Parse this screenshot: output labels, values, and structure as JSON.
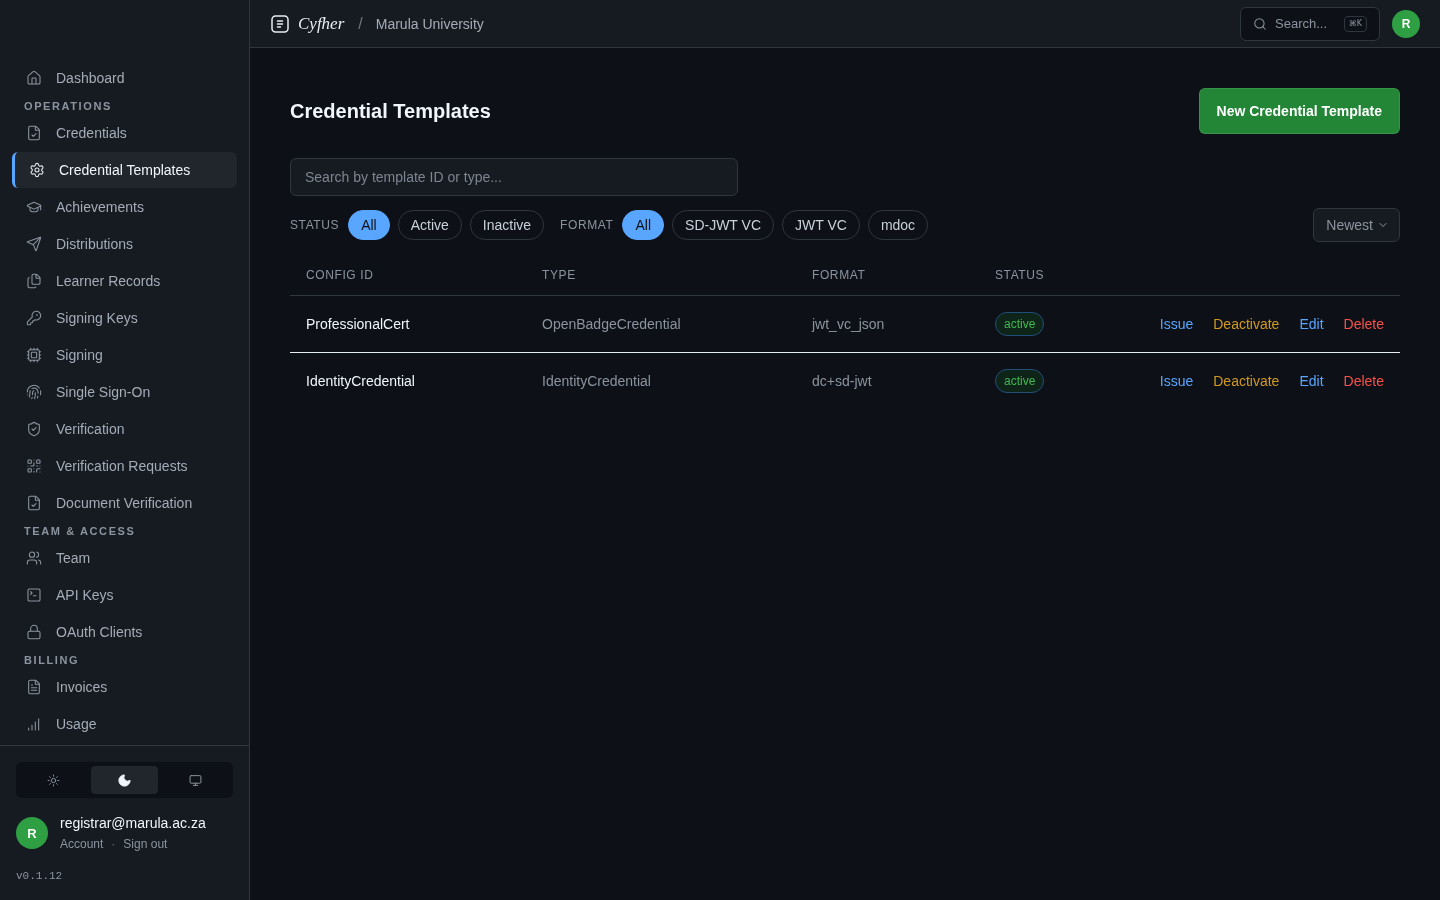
{
  "top_bar": {
    "brand": "Cyfher",
    "separator": "/",
    "organization": "Marula University",
    "search": {
      "label": "Search...",
      "shortcut": "⌘K"
    },
    "avatar": "R"
  },
  "sidebar": {
    "sections": [
      {
        "items": [
          {
            "label": "Dashboard",
            "selected": false
          }
        ]
      },
      {
        "title": "OPERATIONS",
        "items": [
          {
            "label": "Credentials",
            "selected": false
          },
          {
            "label": "Credential Templates",
            "selected": true
          },
          {
            "label": "Achievements",
            "selected": false
          },
          {
            "label": "Distributions",
            "selected": false
          },
          {
            "label": "Learner Records",
            "selected": false
          },
          {
            "label": "Signing Keys",
            "selected": false
          },
          {
            "label": "Signing",
            "selected": false
          },
          {
            "label": "Single Sign-On",
            "selected": false
          },
          {
            "label": "Verification",
            "selected": false
          },
          {
            "label": "Verification Requests",
            "selected": false
          },
          {
            "label": "Document Verification",
            "selected": false
          }
        ]
      },
      {
        "title": "TEAM & ACCESS",
        "items": [
          {
            "label": "Team",
            "selected": false
          },
          {
            "label": "API Keys",
            "selected": false
          },
          {
            "label": "OAuth Clients",
            "selected": false
          }
        ]
      },
      {
        "title": "BILLING",
        "items": [
          {
            "label": "Invoices",
            "selected": false
          },
          {
            "label": "Usage",
            "selected": false
          }
        ]
      }
    ],
    "theme_toggle": [
      {
        "kind": "light",
        "selected": false
      },
      {
        "kind": "dark",
        "selected": true
      },
      {
        "kind": "system",
        "selected": false
      }
    ],
    "user": {
      "avatar": "R",
      "email": "registrar@marula.ac.za",
      "links": [
        "Account",
        "Sign out"
      ],
      "separator": "·"
    },
    "version": "v0.1.12"
  },
  "page": {
    "title": "Credential Templates",
    "primary_button": "New Credential Template",
    "search": {
      "placeholder": "Search by template ID or type..."
    },
    "filters": [
      {
        "label": "STATUS",
        "options": [
          {
            "label": "All",
            "selected": true
          },
          {
            "label": "Active",
            "selected": false
          },
          {
            "label": "Inactive",
            "selected": false
          }
        ]
      },
      {
        "label": "FORMAT",
        "options": [
          {
            "label": "All",
            "selected": true
          },
          {
            "label": "SD-JWT VC",
            "selected": false
          },
          {
            "label": "JWT VC",
            "selected": false
          },
          {
            "label": "mdoc",
            "selected": false
          }
        ]
      }
    ],
    "sort": "Newest"
  },
  "table": {
    "columns": [
      "CONFIG ID",
      "TYPE",
      "FORMAT",
      "STATUS"
    ],
    "rows": [
      {
        "config_id": "ProfessionalCert",
        "type": "OpenBadgeCredential",
        "format": "jwt_vc_json",
        "status": "active",
        "actions": [
          {
            "label": "Issue",
            "color": "#58a6ff"
          },
          {
            "label": "Deactivate",
            "color": "#d29922"
          },
          {
            "label": "Edit",
            "color": "#58a6ff"
          },
          {
            "label": "Delete",
            "color": "#f85149"
          }
        ]
      },
      {
        "config_id": "IdentityCredential",
        "type": "IdentityCredential",
        "format": "dc+sd-jwt",
        "status": "active",
        "actions": [
          {
            "label": "Issue",
            "color": "#58a6ff"
          },
          {
            "label": "Deactivate",
            "color": "#d29922"
          },
          {
            "label": "Edit",
            "color": "#58a6ff"
          },
          {
            "label": "Delete",
            "color": "#f85149"
          }
        ]
      }
    ]
  }
}
